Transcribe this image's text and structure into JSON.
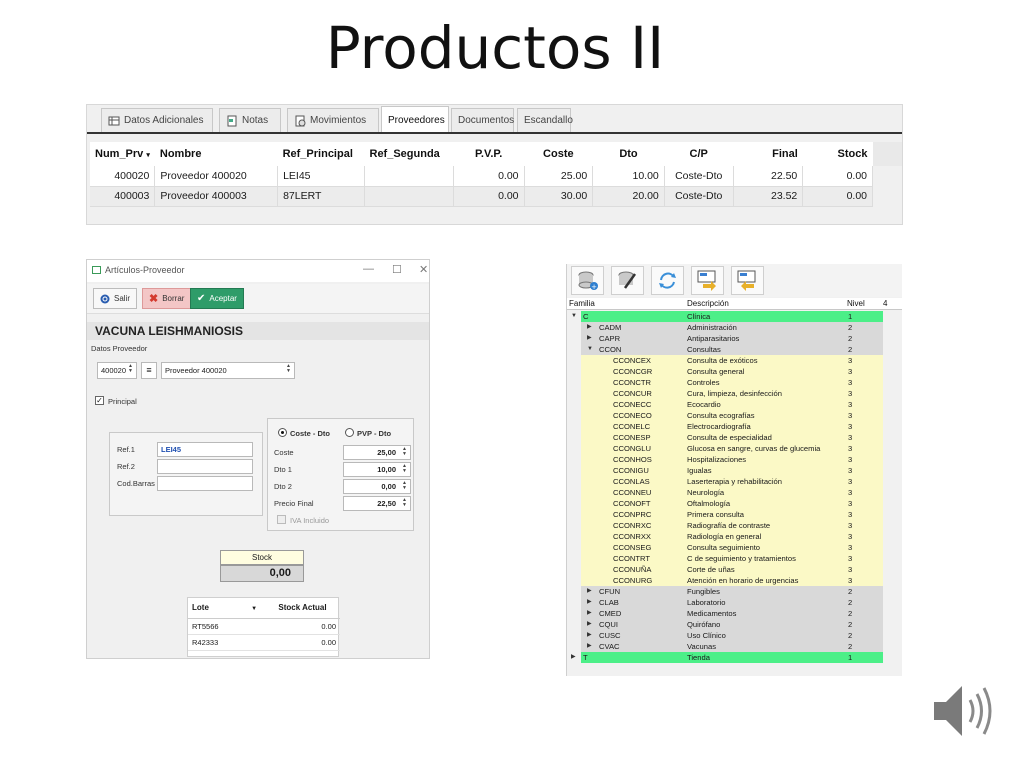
{
  "slide": {
    "title": "Productos II"
  },
  "panel1": {
    "tabs": [
      {
        "label": "Datos Adicionales"
      },
      {
        "label": "Notas"
      },
      {
        "label": "Movimientos"
      },
      {
        "label": "Proveedores"
      },
      {
        "label": "Documentos"
      },
      {
        "label": "Escandallo"
      }
    ],
    "columns": [
      "Num_Prv",
      "Nombre",
      "Ref_Principal",
      "Ref_Segunda",
      "P.V.P.",
      "Coste",
      "Dto",
      "C/P",
      "Final",
      "Stock"
    ],
    "rows": [
      [
        "400020",
        "Proveedor 400020",
        "LEI45",
        "",
        "0.00",
        "25.00",
        "10.00",
        "Coste-Dto",
        "22.50",
        "0.00"
      ],
      [
        "400003",
        "Proveedor 400003",
        "87LERT",
        "",
        "0.00",
        "30.00",
        "20.00",
        "Coste-Dto",
        "23.52",
        "0.00"
      ]
    ]
  },
  "panel2": {
    "window_title": "Artículos-Proveedor",
    "btn_salir": "Salir",
    "btn_borrar": "Borrar",
    "btn_aceptar": "Aceptar",
    "product_name": "VACUNA LEISHMANIOSIS",
    "datos_proveedor": "Datos Proveedor",
    "proveedor_code": "400020",
    "proveedor_name": "Proveedor 400020",
    "principal_label": "Principal",
    "ref1_label": "Ref.1",
    "ref1_value": "LEI45",
    "ref2_label": "Ref.2",
    "codbarras_label": "Cod.Barras",
    "radio_coste_dto": "Coste - Dto",
    "radio_pvp_dto": "PVP - Dto",
    "coste_label": "Coste",
    "coste_value": "25,00",
    "dto1_label": "Dto 1",
    "dto1_value": "10,00",
    "dto2_label": "Dto 2",
    "dto2_value": "0,00",
    "precio_final_label": "Precio Final",
    "precio_final_value": "22,50",
    "iva_label": "IVA Incluido",
    "stock_label": "Stock",
    "stock_value": "0,00",
    "lotes_headers": [
      "Lote",
      "Stock Actual"
    ],
    "lotes_rows": [
      [
        "RT5566",
        "0.00"
      ],
      [
        "R42333",
        "0.00"
      ]
    ]
  },
  "panel3": {
    "headers": [
      "Familia",
      "Descripción",
      "Nivel",
      "4"
    ],
    "rows": [
      {
        "code": "C",
        "desc": "Clínica",
        "nivel": "1",
        "level": 1,
        "arrow": "▼"
      },
      {
        "code": "CADM",
        "desc": "Administración",
        "nivel": "2",
        "level": 2,
        "arrow": "▶"
      },
      {
        "code": "CAPR",
        "desc": "Antiparasitarios",
        "nivel": "2",
        "level": 2,
        "arrow": "▶"
      },
      {
        "code": "CCON",
        "desc": "Consultas",
        "nivel": "2",
        "level": 2,
        "arrow": "▼"
      },
      {
        "code": "CCONCEX",
        "desc": "Consulta de exóticos",
        "nivel": "3",
        "level": 3,
        "arrow": ""
      },
      {
        "code": "CCONCGR",
        "desc": "Consulta general",
        "nivel": "3",
        "level": 3,
        "arrow": ""
      },
      {
        "code": "CCONCTR",
        "desc": "Controles",
        "nivel": "3",
        "level": 3,
        "arrow": ""
      },
      {
        "code": "CCONCUR",
        "desc": "Cura, limpieza, desinfección",
        "nivel": "3",
        "level": 3,
        "arrow": ""
      },
      {
        "code": "CCONECC",
        "desc": "Ecocardio",
        "nivel": "3",
        "level": 3,
        "arrow": ""
      },
      {
        "code": "CCONECO",
        "desc": "Consulta ecografías",
        "nivel": "3",
        "level": 3,
        "arrow": ""
      },
      {
        "code": "CCONELC",
        "desc": "Electrocardiografía",
        "nivel": "3",
        "level": 3,
        "arrow": ""
      },
      {
        "code": "CCONESP",
        "desc": "Consulta de especialidad",
        "nivel": "3",
        "level": 3,
        "arrow": ""
      },
      {
        "code": "CCONGLU",
        "desc": "Glucosa en sangre, curvas de glucemia",
        "nivel": "3",
        "level": 3,
        "arrow": ""
      },
      {
        "code": "CCONHOS",
        "desc": "Hospitalizaciones",
        "nivel": "3",
        "level": 3,
        "arrow": ""
      },
      {
        "code": "CCONIGU",
        "desc": "Igualas",
        "nivel": "3",
        "level": 3,
        "arrow": ""
      },
      {
        "code": "CCONLAS",
        "desc": "Laserterapia y rehabilitación",
        "nivel": "3",
        "level": 3,
        "arrow": ""
      },
      {
        "code": "CCONNEU",
        "desc": "Neurología",
        "nivel": "3",
        "level": 3,
        "arrow": ""
      },
      {
        "code": "CCONOFT",
        "desc": "Oftalmología",
        "nivel": "3",
        "level": 3,
        "arrow": ""
      },
      {
        "code": "CCONPRC",
        "desc": "Primera consulta",
        "nivel": "3",
        "level": 3,
        "arrow": ""
      },
      {
        "code": "CCONRXC",
        "desc": "Radiografía de contraste",
        "nivel": "3",
        "level": 3,
        "arrow": ""
      },
      {
        "code": "CCONRXX",
        "desc": "Radiología en general",
        "nivel": "3",
        "level": 3,
        "arrow": ""
      },
      {
        "code": "CCONSEG",
        "desc": "Consulta seguimiento",
        "nivel": "3",
        "level": 3,
        "arrow": ""
      },
      {
        "code": "CCONTRT",
        "desc": "C de seguimiento y tratamientos",
        "nivel": "3",
        "level": 3,
        "arrow": ""
      },
      {
        "code": "CCONUÑA",
        "desc": "Corte de uñas",
        "nivel": "3",
        "level": 3,
        "arrow": ""
      },
      {
        "code": "CCONURG",
        "desc": "Atención en horario de urgencias",
        "nivel": "3",
        "level": 3,
        "arrow": ""
      },
      {
        "code": "CFUN",
        "desc": "Fungibles",
        "nivel": "2",
        "level": 2,
        "arrow": "▶"
      },
      {
        "code": "CLAB",
        "desc": "Laboratorio",
        "nivel": "2",
        "level": 2,
        "arrow": "▶"
      },
      {
        "code": "CMED",
        "desc": "Medicamentos",
        "nivel": "2",
        "level": 2,
        "arrow": "▶"
      },
      {
        "code": "CQUI",
        "desc": "Quirófano",
        "nivel": "2",
        "level": 2,
        "arrow": "▶"
      },
      {
        "code": "CUSC",
        "desc": "Uso Clínico",
        "nivel": "2",
        "level": 2,
        "arrow": "▶"
      },
      {
        "code": "CVAC",
        "desc": "Vacunas",
        "nivel": "2",
        "level": 2,
        "arrow": "▶"
      },
      {
        "code": "T",
        "desc": "Tienda",
        "nivel": "1",
        "level": 1,
        "arrow": "▶"
      }
    ]
  },
  "icons": {
    "speaker": "speaker-icon",
    "toolbar": [
      "new-record-icon",
      "edit-icon",
      "refresh-icon",
      "export-icon",
      "import-icon"
    ]
  },
  "colors": {
    "level1": "#4cef88",
    "level2": "#d9d9d9",
    "level3": "#fbf9c6",
    "accept": "#2e9c69",
    "delete": "#f3c6c6"
  }
}
